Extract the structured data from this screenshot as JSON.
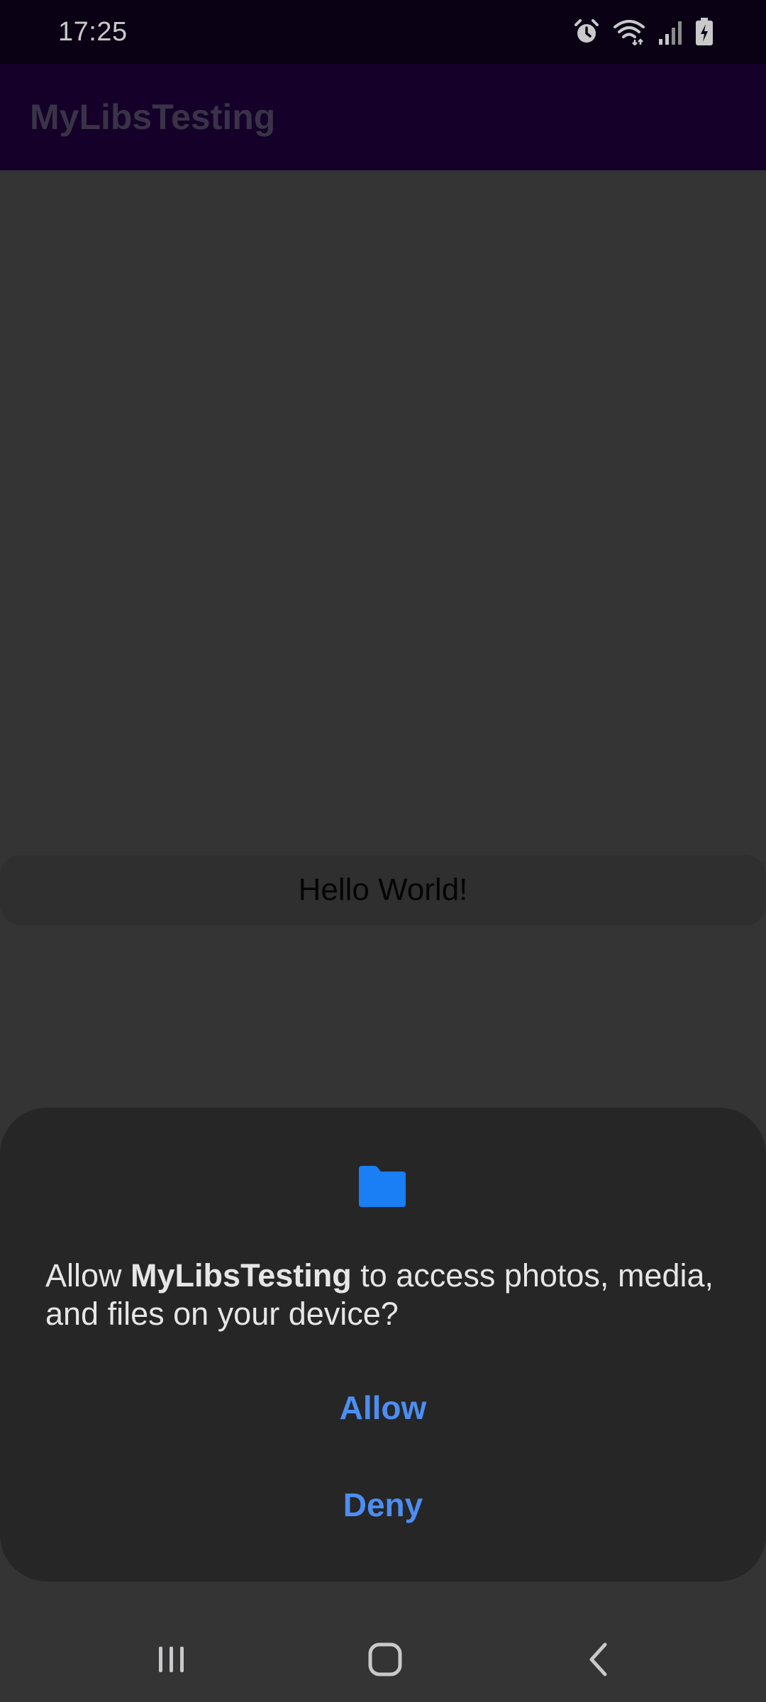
{
  "status_bar": {
    "time": "17:25",
    "icons": [
      "alarm-icon",
      "wifi-icon",
      "signal-icon",
      "battery-charging-icon"
    ]
  },
  "app_bar": {
    "title": "MyLibsTesting"
  },
  "content": {
    "hello_text": "Hello World!"
  },
  "dialog": {
    "icon": "folder-icon",
    "message_prefix": "Allow ",
    "app_name": "MyLibsTesting",
    "message_suffix": " to access photos, media, and files on your device?",
    "allow_label": "Allow",
    "deny_label": "Deny"
  },
  "nav_bar": {
    "icons": [
      "recent-apps-icon",
      "home-icon",
      "back-icon"
    ]
  },
  "colors": {
    "status_bar_bg": "#0a0214",
    "app_bar_bg": "#140029",
    "background": "#343434",
    "dialog_bg": "#262626",
    "accent_blue": "#4c8ef2",
    "folder_blue": "#1a7ef5"
  }
}
